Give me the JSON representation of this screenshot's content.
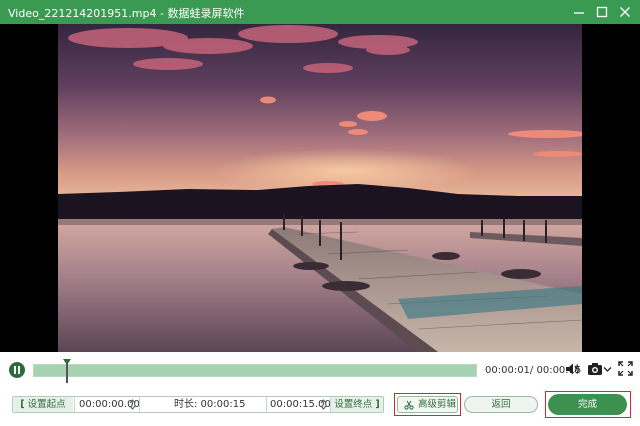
{
  "window": {
    "filename": "Video_221214201951.mp4",
    "separator": "-",
    "app_name": "数据蛙录屏软件",
    "minimize_icon": "minimize-icon",
    "maximize_icon": "maximize-icon",
    "close_icon": "close-icon"
  },
  "player": {
    "state_icon": "pause-icon",
    "progress_fraction": 0.073,
    "time_current": "00:00:01",
    "time_total": "/ 00:00:15",
    "volume_icon": "speaker-icon",
    "snapshot_icon": "camera-icon",
    "fullscreen_icon": "fullscreen-icon"
  },
  "trim": {
    "set_start_label": "设置起点",
    "start_time": "00:00:00.00",
    "duration_label": "时长: 00:00:15",
    "end_time": "00:00:15.00",
    "set_end_label": "设置终点"
  },
  "actions": {
    "advanced_label": "高级剪辑",
    "advanced_icon": "scissors-icon",
    "back_label": "返回",
    "done_label": "完成"
  },
  "colors": {
    "titlebar": "#3b9a51",
    "accent": "#3d9150",
    "highlight_box": "#d9262c"
  }
}
